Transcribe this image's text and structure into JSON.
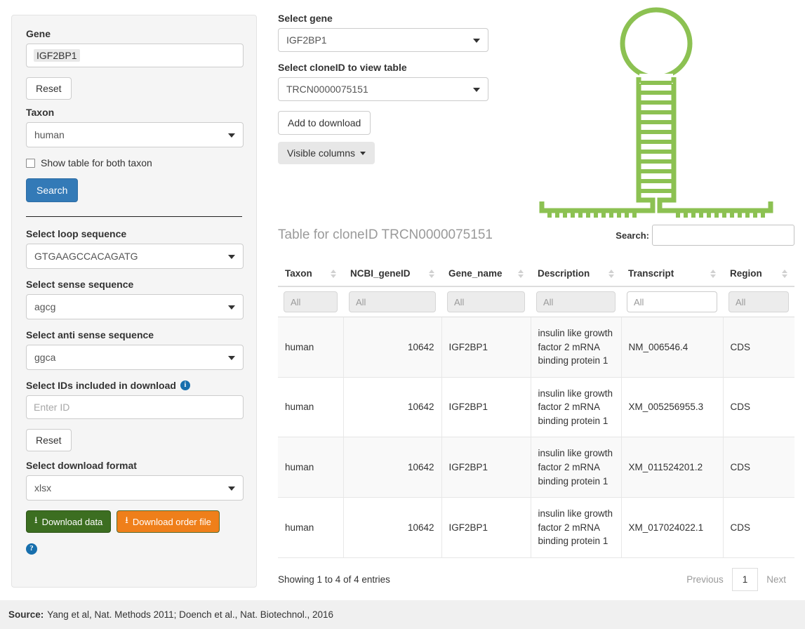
{
  "sidebar": {
    "gene_label": "Gene",
    "gene_value": "IGF2BP1",
    "reset_label_1": "Reset",
    "taxon_label": "Taxon",
    "taxon_value": "human",
    "both_taxon_label": "Show table for both taxon",
    "search_label": "Search",
    "loop_label": "Select loop sequence",
    "loop_value": "GTGAAGCCACAGATG",
    "sense_label": "Select sense sequence",
    "sense_value": "agcg",
    "antisense_label": "Select anti sense sequence",
    "antisense_value": "ggca",
    "ids_label": "Select IDs included in download",
    "ids_placeholder": "Enter ID",
    "ids_value": "",
    "info_icon": "info-icon",
    "reset_label_2": "Reset",
    "format_label": "Select download format",
    "format_value": "xlsx",
    "download_data_label": "Download data",
    "download_order_label": "Download order file",
    "download_icon": "download-icon",
    "help_icon": "help-icon"
  },
  "controls": {
    "select_gene_label": "Select gene",
    "select_gene_value": "IGF2BP1",
    "select_clone_label": "Select cloneID to view table",
    "select_clone_value": "TRCN0000075151",
    "add_to_download_label": "Add to download",
    "visible_columns_label": "Visible columns"
  },
  "graphic": {
    "name": "shrna-hairpin-diagram",
    "color": "#8cc152",
    "stem_rungs": 12,
    "arm_ticks_left": 12,
    "arm_ticks_right": 12
  },
  "table": {
    "title": "Table for cloneID TRCN0000075151",
    "search_label": "Search:",
    "search_value": "",
    "columns": [
      {
        "label": "Taxon",
        "filter": "All",
        "filter_active": false
      },
      {
        "label": "NCBI_geneID",
        "filter": "All",
        "filter_active": false
      },
      {
        "label": "Gene_name",
        "filter": "All",
        "filter_active": false
      },
      {
        "label": "Description",
        "filter": "All",
        "filter_active": false
      },
      {
        "label": "Transcript",
        "filter": "All",
        "filter_active": true
      },
      {
        "label": "Region",
        "filter": "All",
        "filter_active": false
      }
    ],
    "rows": [
      {
        "taxon": "human",
        "ncbi_geneid": "10642",
        "gene_name": "IGF2BP1",
        "description": "insulin like growth factor 2 mRNA binding protein 1",
        "transcript": "NM_006546.4",
        "region": "CDS"
      },
      {
        "taxon": "human",
        "ncbi_geneid": "10642",
        "gene_name": "IGF2BP1",
        "description": "insulin like growth factor 2 mRNA binding protein 1",
        "transcript": "XM_005256955.3",
        "region": "CDS"
      },
      {
        "taxon": "human",
        "ncbi_geneid": "10642",
        "gene_name": "IGF2BP1",
        "description": "insulin like growth factor 2 mRNA binding protein 1",
        "transcript": "XM_011524201.2",
        "region": "CDS"
      },
      {
        "taxon": "human",
        "ncbi_geneid": "10642",
        "gene_name": "IGF2BP1",
        "description": "insulin like growth factor 2 mRNA binding protein 1",
        "transcript": "XM_017024022.1",
        "region": "CDS"
      }
    ],
    "info_text": "Showing 1 to 4 of 4 entries",
    "previous_label": "Previous",
    "page_number": "1",
    "next_label": "Next"
  },
  "footer": {
    "source_label": "Source:",
    "source_text": "Yang et al, Nat. Methods 2011; Doench et al., Nat. Biotechnol., 2016"
  },
  "colors": {
    "primary": "#337ab7",
    "green": "#3c6e21",
    "orange": "#ef7f1a",
    "hairpin": "#8cc152",
    "info_blue": "#176fad"
  }
}
